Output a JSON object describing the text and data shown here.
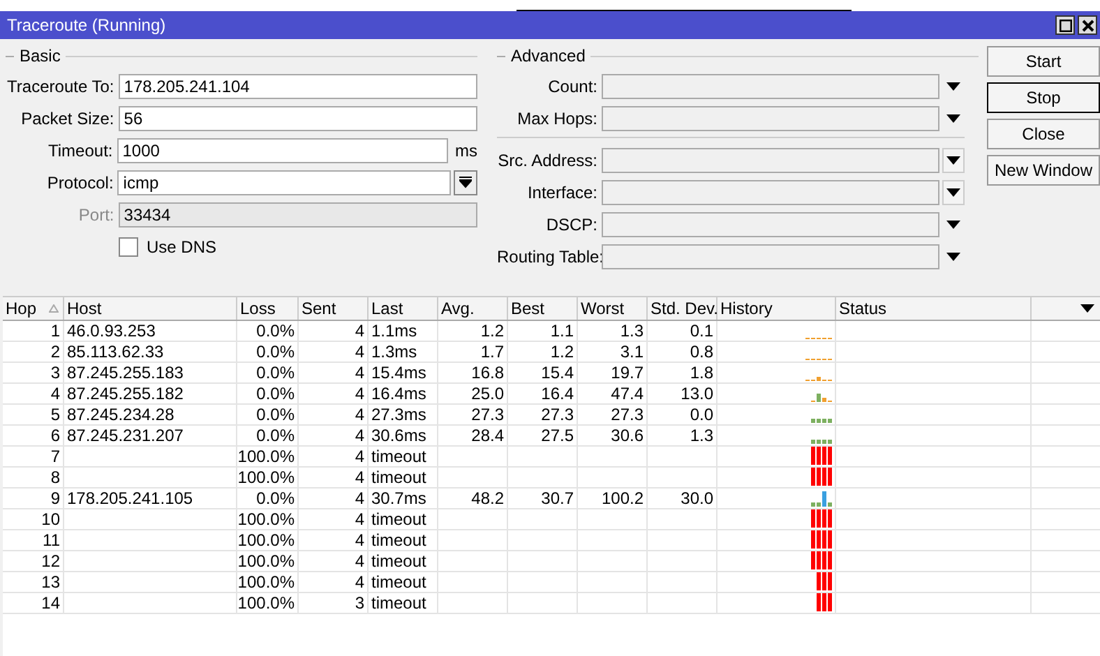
{
  "window": {
    "title": "Traceroute (Running)"
  },
  "basic": {
    "title": "Basic",
    "fields": [
      {
        "label": "Traceroute To:",
        "value": "178.205.241.104",
        "kind": "text",
        "disabled": false
      },
      {
        "label": "Packet Size:",
        "value": "56",
        "kind": "text",
        "disabled": false
      },
      {
        "label": "Timeout:",
        "value": "1000",
        "kind": "unit",
        "unit": "ms",
        "disabled": false
      },
      {
        "label": "Protocol:",
        "value": "icmp",
        "kind": "select",
        "disabled": false
      },
      {
        "label": "Port:",
        "value": "33434",
        "kind": "text",
        "disabled": true
      }
    ],
    "use_dns": {
      "label": "Use DNS",
      "checked": false
    }
  },
  "advanced": {
    "title": "Advanced",
    "fields": [
      {
        "label": "Count:",
        "kind": "dropdown"
      },
      {
        "label": "Max Hops:",
        "kind": "dropdown"
      },
      {
        "label": "Src. Address:",
        "kind": "dropdown-boxed"
      },
      {
        "label": "Interface:",
        "kind": "dropdown-boxed"
      },
      {
        "label": "DSCP:",
        "kind": "dropdown"
      },
      {
        "label": "Routing Table:",
        "kind": "dropdown"
      }
    ]
  },
  "buttons": [
    {
      "label": "Start",
      "focused": false
    },
    {
      "label": "Stop",
      "focused": true
    },
    {
      "label": "Close",
      "focused": false
    },
    {
      "label": "New Window",
      "focused": false
    }
  ],
  "table": {
    "columns": [
      {
        "label": "Hop",
        "sorted": true
      },
      {
        "label": "Host",
        "sorted": false
      },
      {
        "label": "Loss",
        "sorted": false
      },
      {
        "label": "Sent",
        "sorted": false
      },
      {
        "label": "Last",
        "sorted": false
      },
      {
        "label": "Avg.",
        "sorted": false
      },
      {
        "label": "Best",
        "sorted": false
      },
      {
        "label": "Worst",
        "sorted": false
      },
      {
        "label": "Std. Dev.",
        "sorted": false
      },
      {
        "label": "History",
        "sorted": false
      },
      {
        "label": "Status",
        "sorted": false
      }
    ],
    "rows": [
      {
        "hop": "1",
        "host": "46.0.93.253",
        "loss": "0.0%",
        "sent": "4",
        "last": "1.1ms",
        "avg": "1.2",
        "best": "1.1",
        "worst": "1.3",
        "std_dev": "0.1",
        "history": [
          {
            "kind": "fast"
          },
          {
            "kind": "fast"
          },
          {
            "kind": "fast"
          },
          {
            "kind": "fast"
          },
          {
            "kind": "fast"
          }
        ]
      },
      {
        "hop": "2",
        "host": "85.113.62.33",
        "loss": "0.0%",
        "sent": "4",
        "last": "1.3ms",
        "avg": "1.7",
        "best": "1.2",
        "worst": "3.1",
        "std_dev": "0.8",
        "history": [
          {
            "kind": "fast"
          },
          {
            "kind": "fast"
          },
          {
            "kind": "fast"
          },
          {
            "kind": "fast"
          },
          {
            "kind": "fast"
          }
        ]
      },
      {
        "hop": "3",
        "host": "87.245.255.183",
        "loss": "0.0%",
        "sent": "4",
        "last": "15.4ms",
        "avg": "16.8",
        "best": "15.4",
        "worst": "19.7",
        "std_dev": "1.8",
        "history": [
          {
            "kind": "fast"
          },
          {
            "kind": "fast"
          },
          {
            "kind": "bump"
          },
          {
            "kind": "fast"
          },
          {
            "kind": "fast"
          }
        ]
      },
      {
        "hop": "4",
        "host": "87.245.255.182",
        "loss": "0.0%",
        "sent": "4",
        "last": "16.4ms",
        "avg": "25.0",
        "best": "16.4",
        "worst": "47.4",
        "std_dev": "13.0",
        "history": [
          {
            "kind": "fast"
          },
          {
            "kind": "medium"
          },
          {
            "kind": "bump"
          },
          {
            "kind": "fast"
          }
        ]
      },
      {
        "hop": "5",
        "host": "87.245.234.28",
        "loss": "0.0%",
        "sent": "4",
        "last": "27.3ms",
        "avg": "27.3",
        "best": "27.3",
        "worst": "27.3",
        "std_dev": "0.0",
        "history": [
          {
            "kind": "low"
          },
          {
            "kind": "low"
          },
          {
            "kind": "low"
          },
          {
            "kind": "low"
          }
        ]
      },
      {
        "hop": "6",
        "host": "87.245.231.207",
        "loss": "0.0%",
        "sent": "4",
        "last": "30.6ms",
        "avg": "28.4",
        "best": "27.5",
        "worst": "30.6",
        "std_dev": "1.3",
        "history": [
          {
            "kind": "low"
          },
          {
            "kind": "low"
          },
          {
            "kind": "low"
          },
          {
            "kind": "low"
          }
        ]
      },
      {
        "hop": "7",
        "loss": "100.0%",
        "sent": "4",
        "last": "timeout",
        "history": [
          {
            "kind": "timeout"
          },
          {
            "kind": "timeout"
          },
          {
            "kind": "timeout"
          },
          {
            "kind": "timeout"
          }
        ]
      },
      {
        "hop": "8",
        "loss": "100.0%",
        "sent": "4",
        "last": "timeout",
        "history": [
          {
            "kind": "timeout"
          },
          {
            "kind": "timeout"
          },
          {
            "kind": "timeout"
          },
          {
            "kind": "timeout"
          }
        ]
      },
      {
        "hop": "9",
        "host": "178.205.241.105",
        "loss": "0.0%",
        "sent": "4",
        "last": "30.7ms",
        "avg": "48.2",
        "best": "30.7",
        "worst": "100.2",
        "std_dev": "30.0",
        "history": [
          {
            "kind": "low"
          },
          {
            "kind": "low"
          },
          {
            "kind": "slow"
          },
          {
            "kind": "low"
          }
        ]
      },
      {
        "hop": "10",
        "loss": "100.0%",
        "sent": "4",
        "last": "timeout",
        "history": [
          {
            "kind": "timeout"
          },
          {
            "kind": "timeout"
          },
          {
            "kind": "timeout"
          },
          {
            "kind": "timeout"
          }
        ]
      },
      {
        "hop": "11",
        "loss": "100.0%",
        "sent": "4",
        "last": "timeout",
        "history": [
          {
            "kind": "timeout"
          },
          {
            "kind": "timeout"
          },
          {
            "kind": "timeout"
          },
          {
            "kind": "timeout"
          }
        ]
      },
      {
        "hop": "12",
        "loss": "100.0%",
        "sent": "4",
        "last": "timeout",
        "history": [
          {
            "kind": "timeout"
          },
          {
            "kind": "timeout"
          },
          {
            "kind": "timeout"
          },
          {
            "kind": "timeout"
          }
        ]
      },
      {
        "hop": "13",
        "loss": "100.0%",
        "sent": "4",
        "last": "timeout",
        "history": [
          {
            "kind": "timeout"
          },
          {
            "kind": "timeout"
          },
          {
            "kind": "timeout"
          }
        ]
      },
      {
        "hop": "14",
        "loss": "100.0%",
        "sent": "3",
        "last": "timeout",
        "history": [
          {
            "kind": "timeout"
          },
          {
            "kind": "timeout"
          },
          {
            "kind": "timeout"
          }
        ]
      }
    ]
  }
}
